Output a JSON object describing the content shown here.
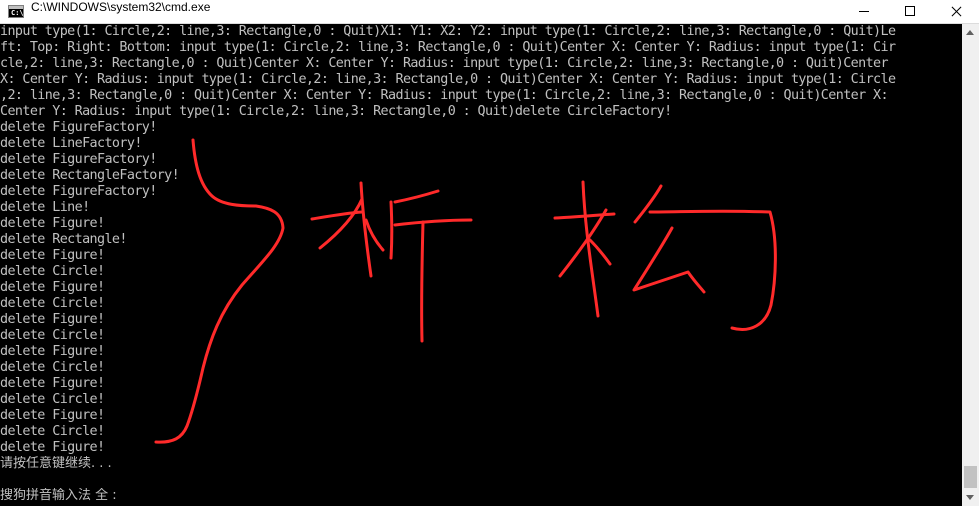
{
  "window": {
    "title": "C:\\WINDOWS\\system32\\cmd.exe",
    "icon": "console-icon",
    "icon_glyph": "C:\\",
    "controls": [
      "minimize",
      "maximize",
      "close"
    ]
  },
  "console": {
    "lines": [
      "input type(1: Circle,2: line,3: Rectangle,0 : Quit)X1: Y1: X2: Y2: input type(1: Circle,2: line,3: Rectangle,0 : Quit)Le",
      "ft: Top: Right: Bottom: input type(1: Circle,2: line,3: Rectangle,0 : Quit)Center X: Center Y: Radius: input type(1: Cir",
      "cle,2: line,3: Rectangle,0 : Quit)Center X: Center Y: Radius: input type(1: Circle,2: line,3: Rectangle,0 : Quit)Center",
      "X: Center Y: Radius: input type(1: Circle,2: line,3: Rectangle,0 : Quit)Center X: Center Y: Radius: input type(1: Circle",
      ",2: line,3: Rectangle,0 : Quit)Center X: Center Y: Radius: input type(1: Circle,2: line,3: Rectangle,0 : Quit)Center X:",
      "Center Y: Radius: input type(1: Circle,2: line,3: Rectangle,0 : Quit)delete CircleFactory!",
      "delete FigureFactory!",
      "delete LineFactory!",
      "delete FigureFactory!",
      "delete RectangleFactory!",
      "delete FigureFactory!",
      "delete Line!",
      "delete Figure!",
      "delete Rectangle!",
      "delete Figure!",
      "delete Circle!",
      "delete Figure!",
      "delete Circle!",
      "delete Figure!",
      "delete Circle!",
      "delete Figure!",
      "delete Circle!",
      "delete Figure!",
      "delete Circle!",
      "delete Figure!",
      "delete Circle!",
      "delete Figure!",
      "请按任意键继续. . .",
      "",
      "搜狗拼音输入法 全 :"
    ]
  },
  "annotation": {
    "color": "#ff2a2a",
    "handwritten_text": "析构"
  },
  "colors": {
    "console_bg": "#000000",
    "console_fg": "#c0c0c0",
    "titlebar_bg": "#ffffff",
    "scrollbar_bg": "#f0f0f0"
  }
}
